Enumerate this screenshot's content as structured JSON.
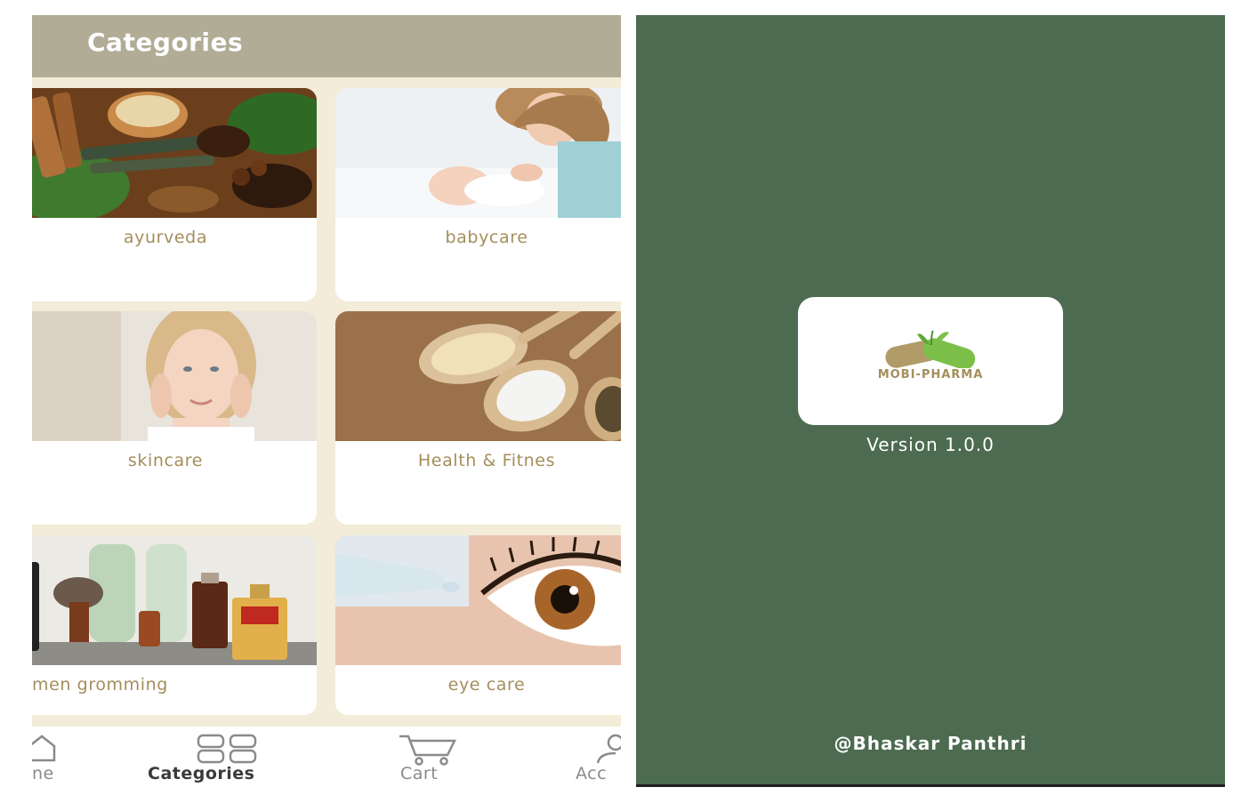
{
  "categories_screen": {
    "title": "Categories",
    "items": [
      {
        "label": "ayurveda",
        "image": "ayurveda-spices-photo"
      },
      {
        "label": "babycare",
        "image": "mother-and-baby-photo"
      },
      {
        "label": "skincare",
        "image": "woman-skincare-photo"
      },
      {
        "label": "Health & Fitnes",
        "image": "supplement-capsules-spoons-photo"
      },
      {
        "label": "men gromming",
        "image": "grooming-products-photo"
      },
      {
        "label": "eye care",
        "image": "eye-drops-photo"
      }
    ],
    "bottom_nav": [
      {
        "label": "ne",
        "icon": "home-icon"
      },
      {
        "label": "Categories",
        "icon": "grid-icon",
        "active": true
      },
      {
        "label": "Cart",
        "icon": "cart-icon"
      },
      {
        "label": "Acc",
        "icon": "account-icon"
      }
    ]
  },
  "splash_screen": {
    "logo_text": "MOBI-PHARMA",
    "version": "Version 1.0.0",
    "author": "@Bhaskar Panthri"
  },
  "colors": {
    "appbar": "#b1ac96",
    "background": "#f2ecd8",
    "label_gold": "#a48e5c",
    "splash_green": "#4d6b50"
  }
}
